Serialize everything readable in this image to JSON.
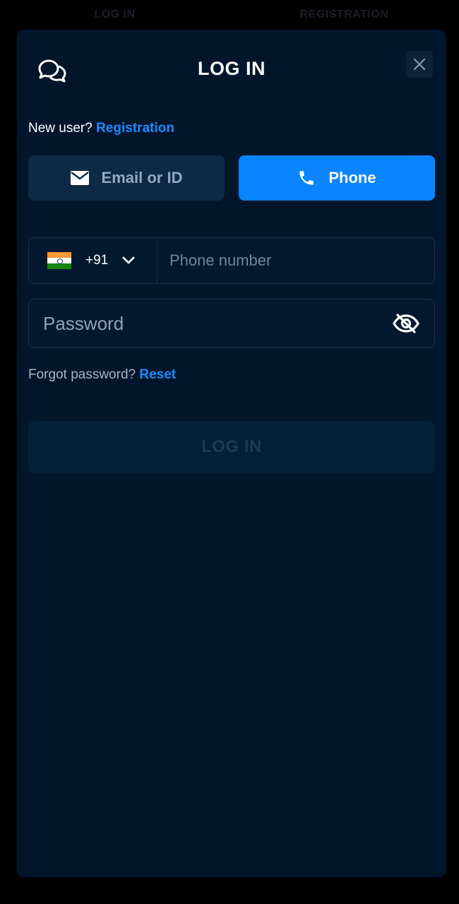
{
  "backdrop": {
    "tabs": [
      "LOG IN",
      "REGISTRATION"
    ]
  },
  "header": {
    "title": "LOG IN",
    "chat_icon": "chat-bubbles-icon",
    "close_icon": "close-icon"
  },
  "new_user": {
    "prompt": "New user?",
    "link": "Registration"
  },
  "methods": {
    "email": {
      "label": "Email or ID",
      "icon": "mail-icon",
      "active": false
    },
    "phone": {
      "label": "Phone",
      "icon": "phone-icon",
      "active": true
    }
  },
  "phone_field": {
    "country_code": "+91",
    "country_flag": "india-flag-icon",
    "placeholder": "Phone number",
    "value": ""
  },
  "password_field": {
    "placeholder": "Password",
    "value": "",
    "toggle_icon": "eye-off-icon"
  },
  "forgot": {
    "prompt": "Forgot password?",
    "link": "Reset"
  },
  "submit": {
    "label": "LOG IN",
    "enabled": false
  },
  "colors": {
    "accent": "#0a84ff",
    "link": "#1a8cff",
    "modal_bg": "#01152b",
    "flag_saffron": "#ff9933",
    "flag_green": "#138808"
  }
}
